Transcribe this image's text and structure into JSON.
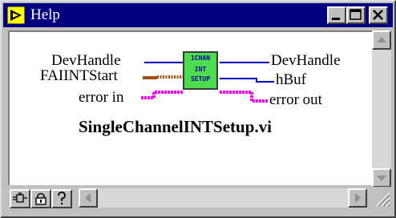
{
  "window": {
    "title": "Help",
    "buttons": [
      "minimize",
      "maximize",
      "close"
    ]
  },
  "diagram": {
    "inputs": {
      "dev_handle": "DevHandle",
      "fai_int_start": "FAIINTStart",
      "error_in": "error in"
    },
    "outputs": {
      "dev_handle": "DevHandle",
      "hbuf": "hBuf",
      "error_out": "error out"
    },
    "node": {
      "line1": "1CHAN",
      "line2": "INT",
      "line3": "SETUP"
    },
    "vi_name": "SingleChannelINTSetup.vi",
    "colors": {
      "wire_numeric": "#0000c0",
      "wire_string": "#a05010",
      "wire_cluster": "#ff00ff",
      "node_fill": "#4ddc4d"
    }
  },
  "bottom_toolbar": {
    "buttons": [
      "simple-diagram-icon",
      "lock-icon",
      "question-icon"
    ]
  }
}
